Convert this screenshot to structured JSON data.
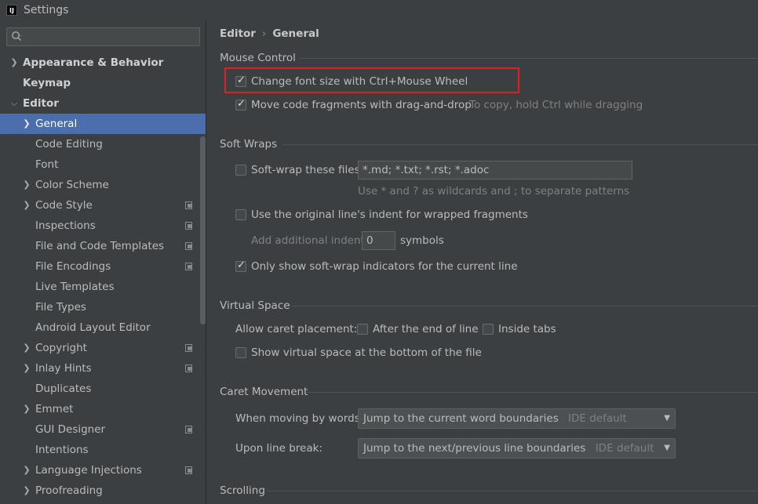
{
  "window": {
    "title": "Settings",
    "logo": "IJ"
  },
  "search": {
    "placeholder": "",
    "value": ""
  },
  "sidebar": {
    "items": [
      {
        "label": "Appearance & Behavior"
      },
      {
        "label": "Keymap"
      },
      {
        "label": "Editor"
      },
      {
        "label": "General"
      },
      {
        "label": "Code Editing"
      },
      {
        "label": "Font"
      },
      {
        "label": "Color Scheme"
      },
      {
        "label": "Code Style"
      },
      {
        "label": "Inspections"
      },
      {
        "label": "File and Code Templates"
      },
      {
        "label": "File Encodings"
      },
      {
        "label": "Live Templates"
      },
      {
        "label": "File Types"
      },
      {
        "label": "Android Layout Editor"
      },
      {
        "label": "Copyright"
      },
      {
        "label": "Inlay Hints"
      },
      {
        "label": "Duplicates"
      },
      {
        "label": "Emmet"
      },
      {
        "label": "GUI Designer"
      },
      {
        "label": "Intentions"
      },
      {
        "label": "Language Injections"
      },
      {
        "label": "Proofreading"
      }
    ]
  },
  "breadcrumb": {
    "parent": "Editor",
    "current": "General"
  },
  "mouse_control": {
    "title": "Mouse Control",
    "ctrl_wheel": {
      "label": "Change font size with Ctrl+Mouse Wheel",
      "checked": true
    },
    "drag_drop": {
      "label": "Move code fragments with drag-and-drop",
      "checked": true,
      "hint": "To copy, hold Ctrl while dragging"
    }
  },
  "soft_wraps": {
    "title": "Soft Wraps",
    "files": {
      "label": "Soft-wrap these files:",
      "value": "*.md; *.txt; *.rst; *.adoc",
      "checked": false,
      "hint": "Use * and ? as wildcards and ; to separate patterns"
    },
    "indent": {
      "label": "Use the original line's indent for wrapped fragments",
      "checked": false
    },
    "additional": {
      "label": "Add additional indent:",
      "value": "0",
      "unit": "symbols"
    },
    "indicators": {
      "label": "Only show soft-wrap indicators for the current line",
      "checked": true
    }
  },
  "virtual_space": {
    "title": "Virtual Space",
    "caret_label": "Allow caret placement:",
    "after_end": {
      "label": "After the end of line",
      "checked": false
    },
    "inside_tabs": {
      "label": "Inside tabs",
      "checked": false
    },
    "bottom": {
      "label": "Show virtual space at the bottom of the file",
      "checked": false
    }
  },
  "caret_movement": {
    "title": "Caret Movement",
    "words": {
      "label": "When moving by words:",
      "value": "Jump to the current word boundaries",
      "suffix": "IDE default"
    },
    "line_break": {
      "label": "Upon line break:",
      "value": "Jump to the next/previous line boundaries",
      "suffix": "IDE default"
    }
  },
  "scrolling": {
    "title": "Scrolling"
  }
}
